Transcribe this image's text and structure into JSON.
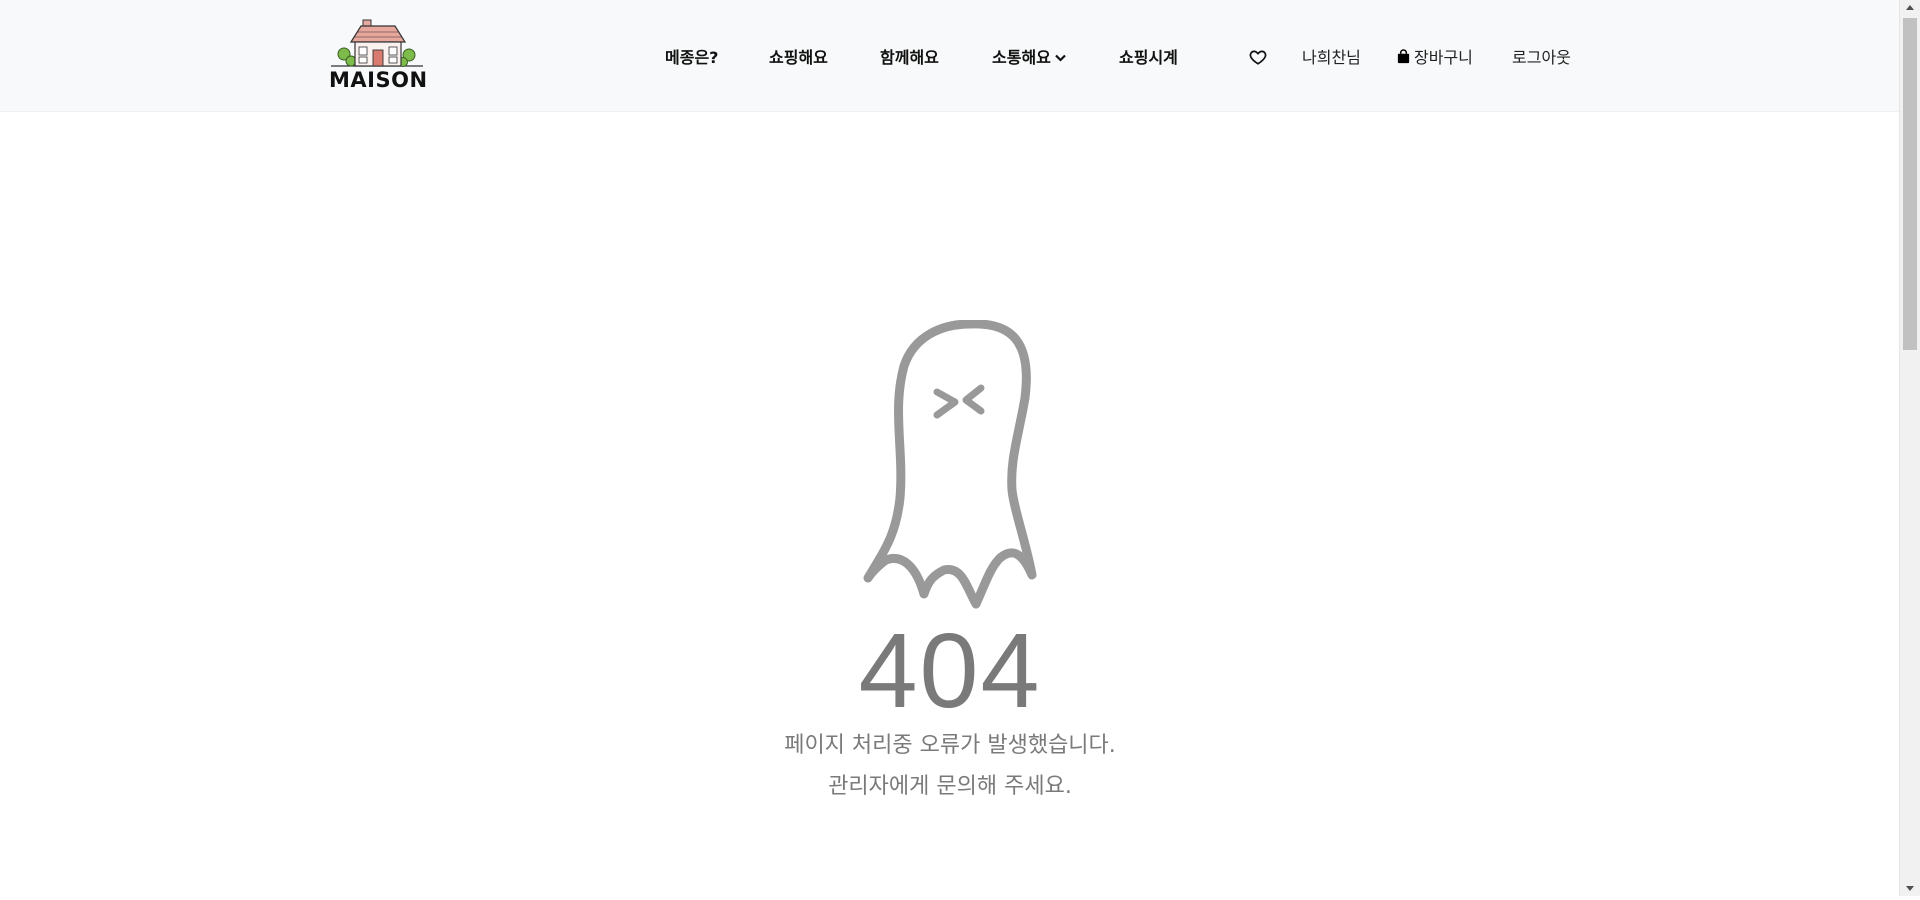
{
  "header": {
    "logo_text": "MAISON",
    "nav": [
      {
        "label": "메종은?"
      },
      {
        "label": "쇼핑해요"
      },
      {
        "label": "함께해요"
      },
      {
        "label": "소통해요",
        "has_dropdown": true
      },
      {
        "label": "쇼핑시계"
      }
    ],
    "utility": {
      "wishlist_icon": "heart-icon",
      "user_label": "나희찬님",
      "cart_icon": "shopping-bag-icon",
      "cart_label": "장바구니",
      "logout_label": "로그아웃"
    }
  },
  "error": {
    "illustration": "ghost-icon",
    "code": "404",
    "line1": "페이지 처리중 오류가 발생했습니다.",
    "line2": "관리자에게 문의해 주세요."
  },
  "colors": {
    "header_bg": "#f8f9fa",
    "text_muted": "#7a7a7a",
    "ghost_stroke": "#999999"
  }
}
